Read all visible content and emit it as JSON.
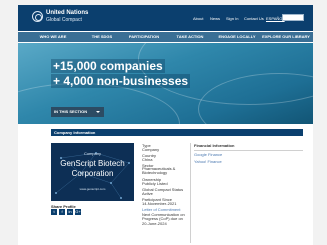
{
  "header": {
    "brand_line1": "United Nations",
    "brand_line2": "Global Compact",
    "links": [
      "About",
      "News",
      "Sign In",
      "Contact Us"
    ],
    "language": "ESPAÑOL"
  },
  "nav": {
    "items": [
      "WHO WE ARE",
      "THE SDGS",
      "PARTICIPATION",
      "TAKE ACTION",
      "ENGAGE LOCALLY",
      "EXPLORE OUR LIBRARY"
    ]
  },
  "hero": {
    "line1": "+15,000 companies",
    "line2": "+ 4,000 non-businesses",
    "in_this_section": "IN THIS SECTION"
  },
  "company": {
    "section_title": "Company Information",
    "cover_top": "Company",
    "cover_name_line1": "GenScript Biotech",
    "cover_name_line2": "Corporation",
    "cover_url": "www.genscript.com",
    "details": [
      {
        "label": "Type",
        "value": "Company"
      },
      {
        "label": "Country",
        "value": "China"
      },
      {
        "label": "Sector",
        "value": "Pharmaceuticals & Biotechnology"
      },
      {
        "label": "Ownership",
        "value": "Publicly Listed"
      },
      {
        "label": "Global Compact Status",
        "value": "Active"
      },
      {
        "label": "Participant Since",
        "value": "14-November-2021"
      },
      {
        "label": "",
        "value": "Letter of Commitment"
      },
      {
        "label": "Next Communication on Progress (CoP) due on",
        "value": "20-June-2024"
      }
    ],
    "financial_title": "Financial Information",
    "financial_links": [
      "Google Finance",
      "Yahoo! Finance"
    ]
  },
  "share": {
    "label": "Share Profile",
    "icons": [
      "twitter-icon",
      "facebook-icon",
      "linkedin-icon",
      "google-plus-icon"
    ],
    "glyphs": [
      "t",
      "f",
      "in",
      "G+"
    ]
  }
}
